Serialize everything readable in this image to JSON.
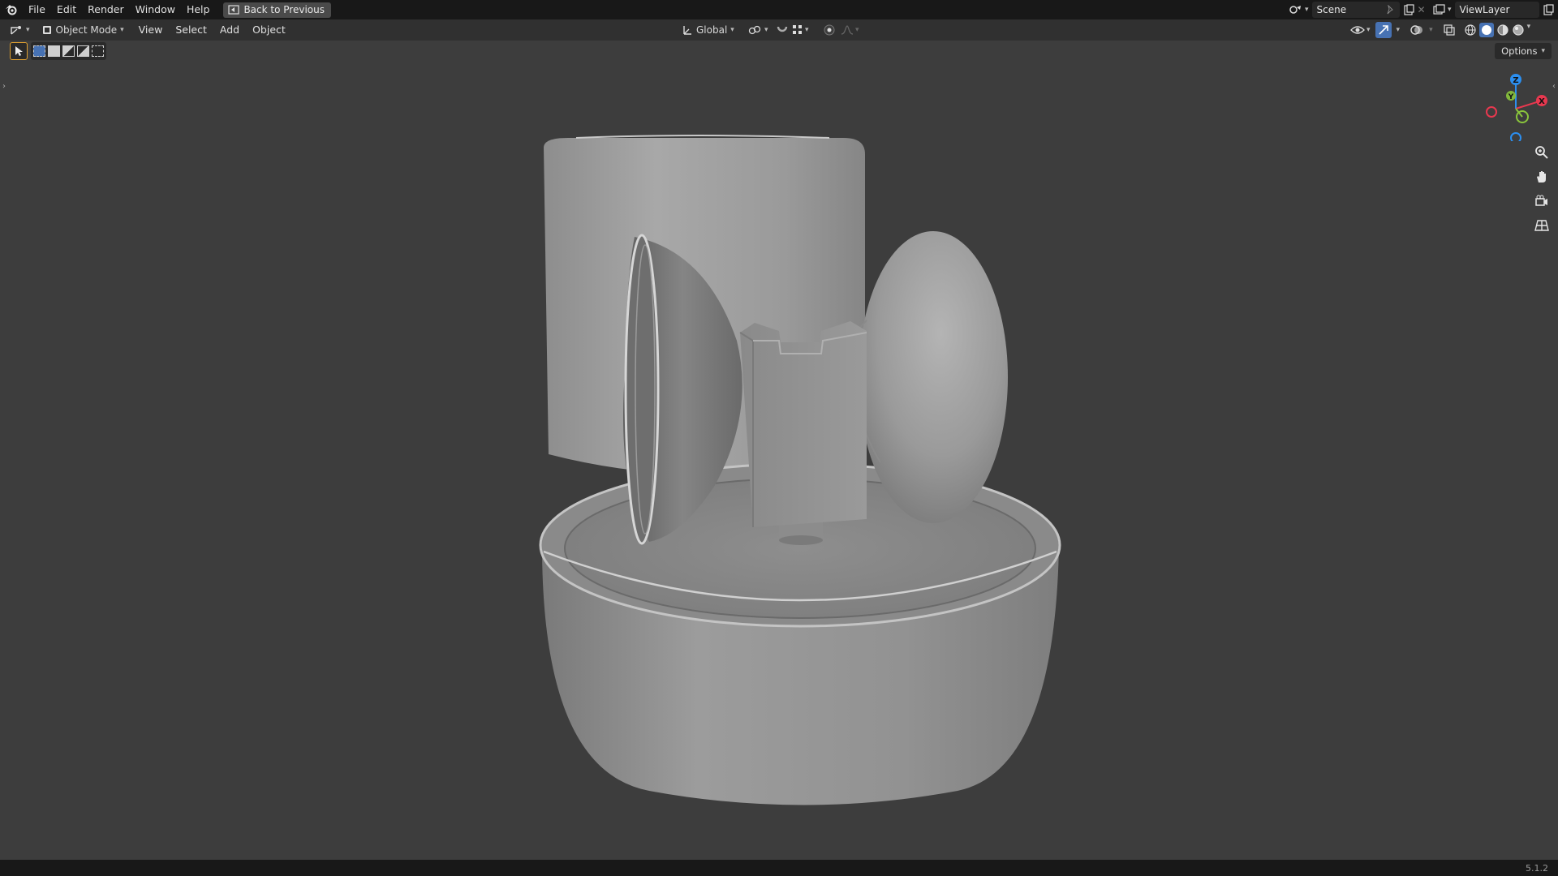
{
  "topbar": {
    "menus": [
      "File",
      "Edit",
      "Render",
      "Window",
      "Help"
    ],
    "back_label": "Back to Previous",
    "scene_label": "Scene",
    "viewlayer_label": "ViewLayer"
  },
  "header": {
    "mode_label": "Object Mode",
    "menus": [
      "View",
      "Select",
      "Add",
      "Object"
    ],
    "transform_orientation": "Global",
    "options_label": "Options"
  },
  "gizmo": {
    "z_label": "Z",
    "y_label": "Y",
    "x_label": "X",
    "colors": {
      "x": "#e8384f",
      "y": "#8ac53c",
      "z": "#2c8ff0"
    }
  },
  "status": {
    "version": "5.1.2"
  },
  "theme": {
    "active_accent": "#4772b3",
    "tool_active": "#e0a030"
  }
}
